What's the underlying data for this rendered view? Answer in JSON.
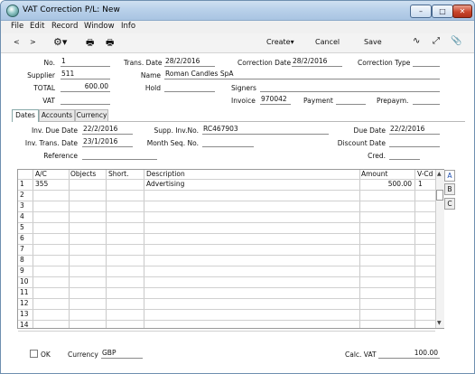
{
  "window": {
    "title": "VAT Correction P/L: New"
  },
  "menu": [
    "File",
    "Edit",
    "Record",
    "Window",
    "Info"
  ],
  "toolbar": {
    "back": "<",
    "forward": ">",
    "create": "Create",
    "cancel": "Cancel",
    "save": "Save"
  },
  "header": {
    "no_label": "No.",
    "no": "1",
    "trans_date_label": "Trans. Date",
    "trans_date": "28/2/2016",
    "correction_date_label": "Correction Date",
    "correction_date": "28/2/2016",
    "correction_type_label": "Correction Type",
    "correction_type": "",
    "supplier_label": "Supplier",
    "supplier": "511",
    "name_label": "Name",
    "name": "Roman Candles SpA",
    "total_label": "TOTAL",
    "total": "600.00",
    "hold_label": "Hold",
    "hold": "",
    "signers_label": "Signers",
    "signers": "",
    "vat_label": "VAT",
    "vat": "",
    "invoice_label": "Invoice",
    "invoice": "970042",
    "payment_label": "Payment",
    "payment": "",
    "prepaym_label": "Prepaym.",
    "prepaym": ""
  },
  "tabs": [
    "Dates",
    "Accounts",
    "Currency"
  ],
  "dates": {
    "inv_due_date_label": "Inv. Due Date",
    "inv_due_date": "22/2/2016",
    "supp_inv_no_label": "Supp. Inv.No.",
    "supp_inv_no": "RC467903",
    "due_date_label": "Due Date",
    "due_date": "22/2/2016",
    "inv_trans_date_label": "Inv. Trans. Date",
    "inv_trans_date": "23/1/2016",
    "month_seq_no_label": "Month Seq. No.",
    "month_seq_no": "",
    "discount_date_label": "Discount Date",
    "discount_date": "",
    "reference_label": "Reference",
    "reference": "",
    "cred_label": "Cred.",
    "cred": ""
  },
  "grid": {
    "columns": [
      "A/C",
      "Objects",
      "Short.",
      "Description",
      "Amount",
      "V-Cd"
    ],
    "row_numbers": [
      "1",
      "2",
      "3",
      "4",
      "5",
      "6",
      "7",
      "8",
      "9",
      "10",
      "11",
      "12",
      "13",
      "14"
    ],
    "rows": [
      {
        "ac": "355",
        "objects": "",
        "short": "",
        "description": "Advertising",
        "amount": "500.00",
        "vcd": "1"
      }
    ],
    "side_tabs": [
      "A",
      "B",
      "C"
    ]
  },
  "footer": {
    "ok_label": "OK",
    "currency_label": "Currency",
    "currency": "GBP",
    "calc_vat_label": "Calc. VAT",
    "calc_vat": "100.00"
  }
}
